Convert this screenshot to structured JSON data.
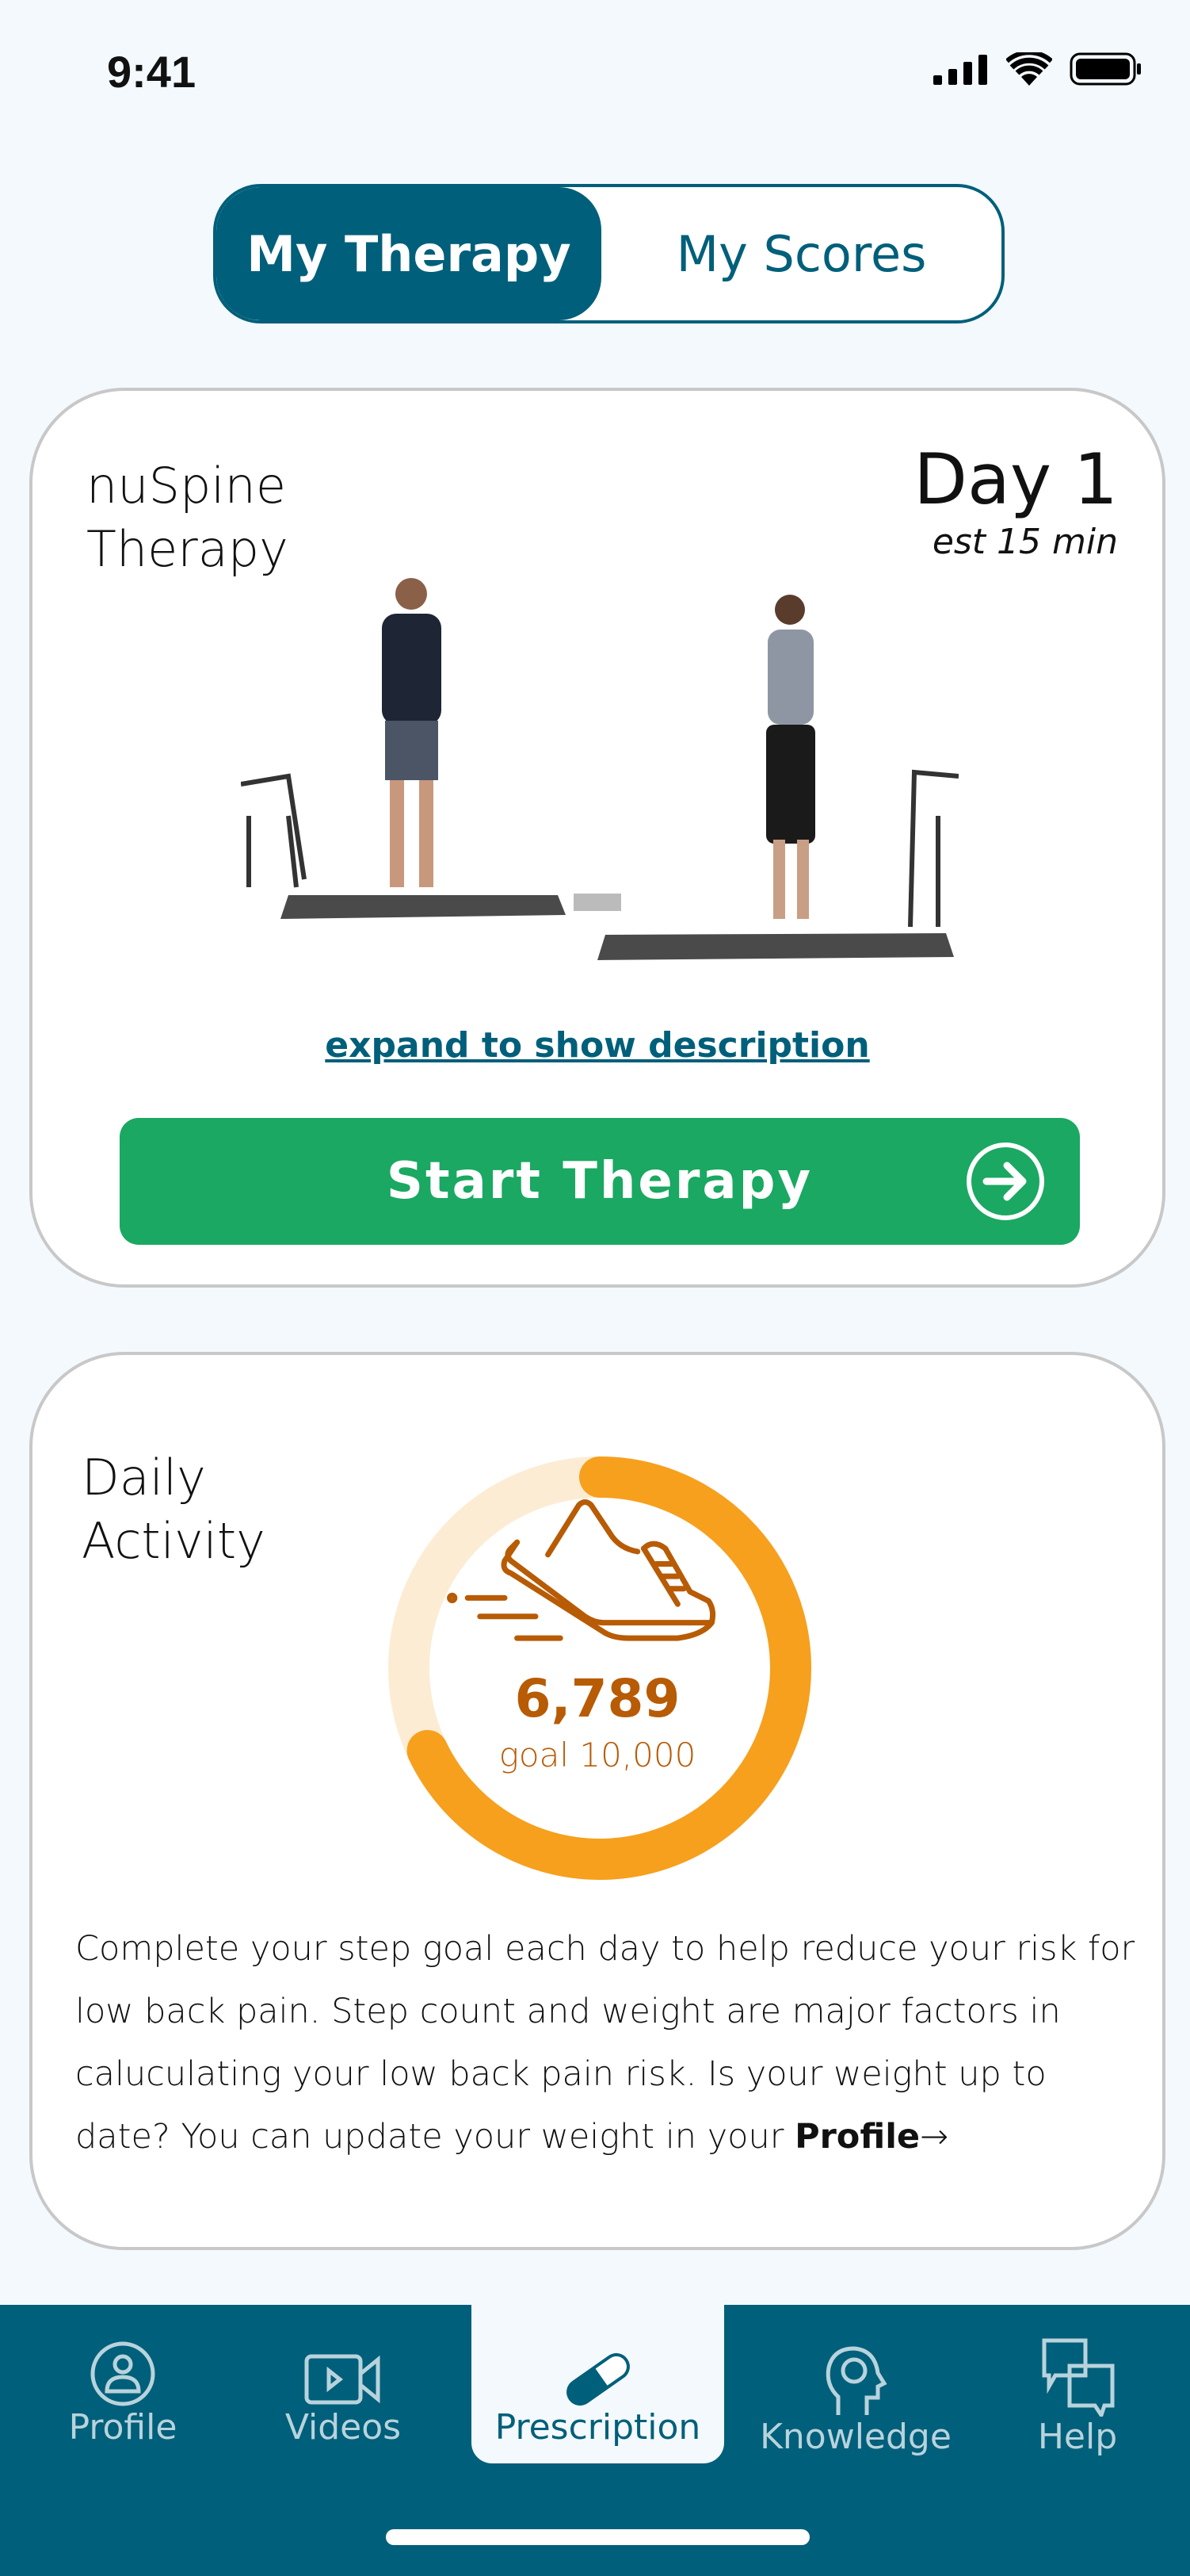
{
  "status_bar": {
    "time": "9:41",
    "icons": [
      "cellular-signal-icon",
      "wifi-icon",
      "battery-icon"
    ]
  },
  "segmented": {
    "tabs": [
      {
        "label": "My Therapy",
        "active": true
      },
      {
        "label": "My Scores",
        "active": false
      }
    ]
  },
  "therapy_card": {
    "title_line1": "nuSpine",
    "title_line2": "Therapy",
    "day": "Day 1",
    "estimate": "est 15 min",
    "expand_link": "expand to show description",
    "start_button": "Start Therapy"
  },
  "activity_card": {
    "title_line1": "Daily",
    "title_line2": "Activity",
    "steps": "6,789",
    "goal": "goal 10,000",
    "progress_percent": 67.89,
    "paragraph": "Complete your step goal each day to help reduce your risk for low back pain. Step count and weight are major factors in caluculating your low back pain risk. Is your weight up to date? You can update your weight in your ",
    "profile_link": "Profile",
    "colors": {
      "ring": "#f6a01e",
      "track": "#fdecd4",
      "text": "#b85b05"
    }
  },
  "nav": {
    "items": [
      {
        "label": "Profile",
        "icon": "profile-icon"
      },
      {
        "label": "Videos",
        "icon": "video-icon"
      },
      {
        "label": "Prescription",
        "icon": "pill-icon",
        "active": true
      },
      {
        "label": "Knowledge",
        "icon": "brain-head-icon"
      },
      {
        "label": "Help",
        "icon": "chat-bubbles-icon"
      }
    ]
  },
  "colors": {
    "primary": "#005f7a",
    "green": "#1aa862",
    "background": "#f3f9fc"
  }
}
